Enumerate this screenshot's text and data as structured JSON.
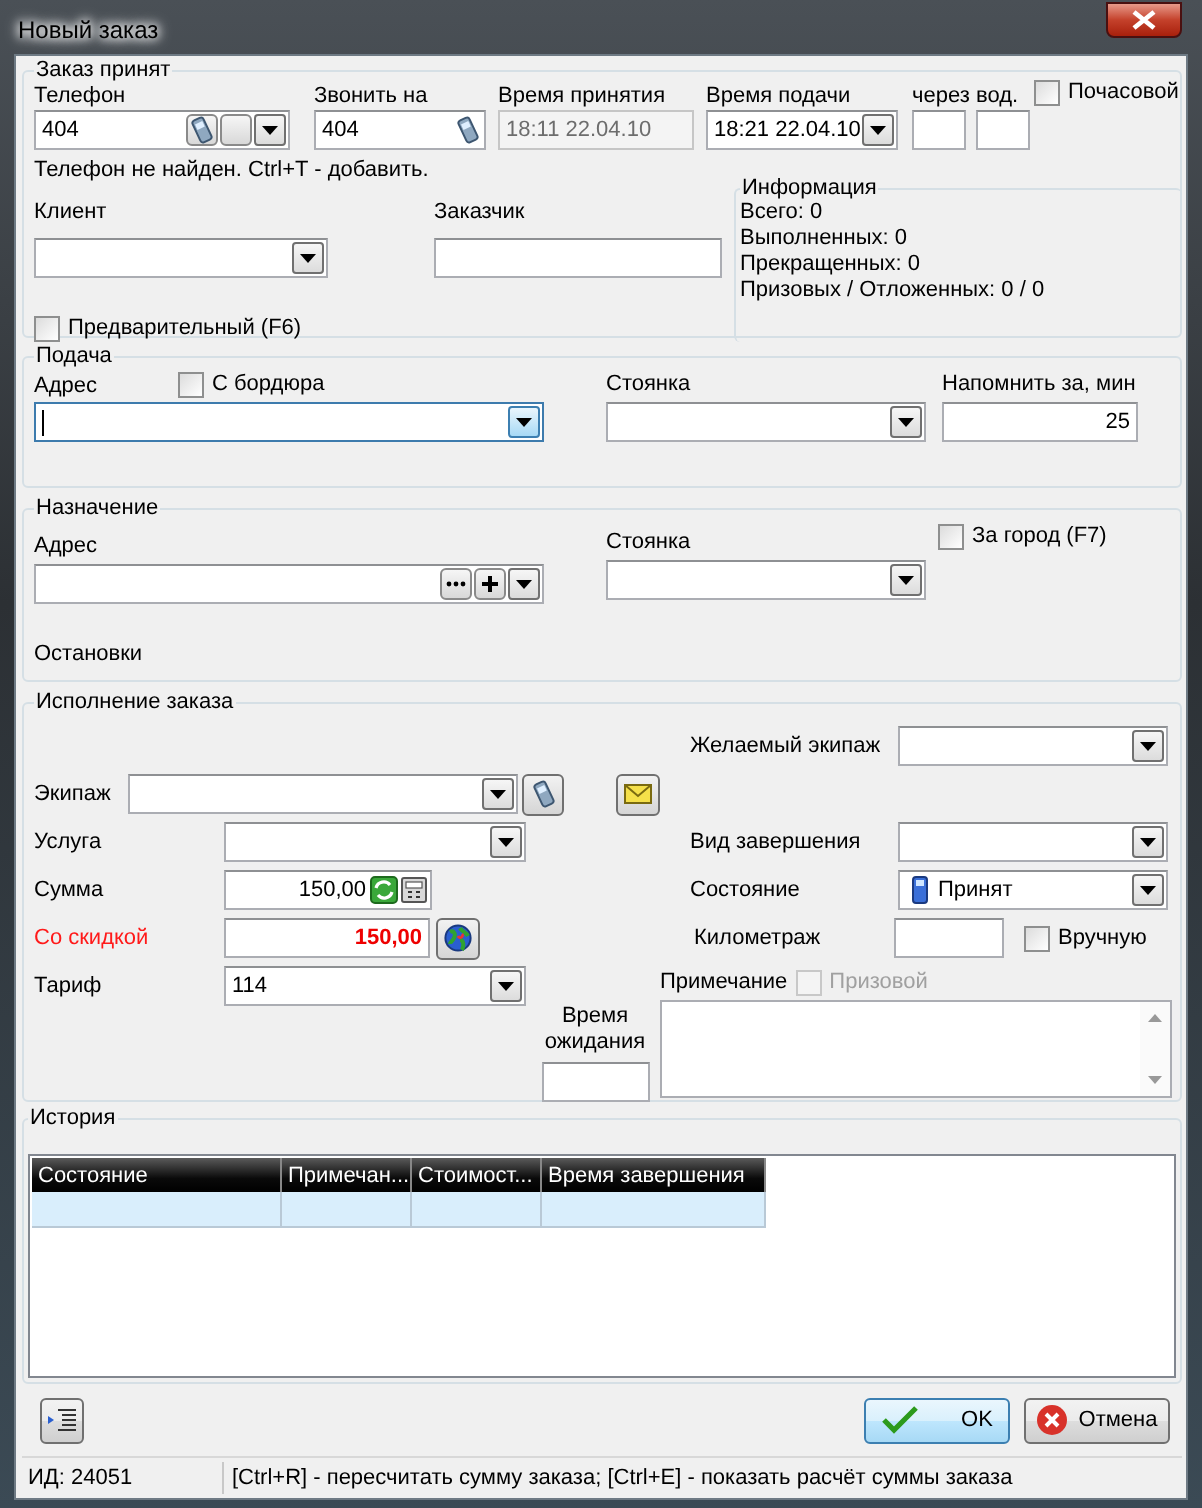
{
  "window": {
    "title": "Новый заказ"
  },
  "order_received": {
    "legend": "Заказ принят",
    "phone": {
      "label": "Телефон",
      "value": "404"
    },
    "call_to": {
      "label": "Звонить на",
      "value": "404"
    },
    "accept_time": {
      "label": "Время принятия",
      "value": "18:11 22.04.10",
      "disabled": true
    },
    "pickup_time": {
      "label": "Время подачи",
      "value": "18:21 22.04.10",
      "disabled": false
    },
    "after": {
      "label": "через"
    },
    "driver": {
      "label": "вод."
    },
    "hourly": {
      "label": "Почасовой",
      "checked": false,
      "disabled": false
    },
    "phone_hint": "Телефон не найден. Ctrl+T - добавить.",
    "client": {
      "label": "Клиент"
    },
    "customer": {
      "label": "Заказчик"
    },
    "preliminary": {
      "label": "Предварительный (F6)",
      "checked": false,
      "disabled": false
    },
    "info": {
      "legend": "Информация",
      "lines": [
        "Всего: 0",
        "Выполненных: 0",
        "Прекращенных: 0",
        "Призовых / Отложенных: 0 / 0"
      ]
    }
  },
  "pickup": {
    "legend": "Подача",
    "address": {
      "label": "Адрес",
      "focused": true
    },
    "curb": {
      "label": "С бордюра",
      "checked": false,
      "disabled": false
    },
    "parking": {
      "label": "Стоянка"
    },
    "remind": {
      "label": "Напомнить за, мин",
      "value": "25"
    }
  },
  "destination": {
    "legend": "Назначение",
    "address": {
      "label": "Адрес"
    },
    "parking": {
      "label": "Стоянка"
    },
    "out_of_town": {
      "label": "За город (F7)",
      "checked": false,
      "disabled": false
    },
    "stops_label": "Остановки"
  },
  "execution": {
    "legend": "Исполнение заказа",
    "desired_crew": {
      "label": "Желаемый экипаж"
    },
    "crew": {
      "label": "Экипаж"
    },
    "service": {
      "label": "Услуга"
    },
    "completion_type": {
      "label": "Вид завершения"
    },
    "sum": {
      "label": "Сумма",
      "value": "150,00"
    },
    "status": {
      "label": "Состояние",
      "value": "Принят"
    },
    "discounted": {
      "label": "Со скидкой",
      "value": "150,00"
    },
    "mileage": {
      "label": "Километраж"
    },
    "manual": {
      "label": "Вручную",
      "checked": false,
      "disabled": false
    },
    "tariff": {
      "label": "Тариф",
      "value": "114"
    },
    "note": {
      "label": "Примечание"
    },
    "prize": {
      "label": "Призовой",
      "checked": false,
      "disabled": true
    },
    "wait_time": {
      "label": "Время ожидания"
    }
  },
  "history": {
    "legend": "История",
    "columns": [
      "Состояние",
      "Примечан...",
      "Стоимост...",
      "Время завершения"
    ],
    "rows": [
      {
        "selected": true
      }
    ]
  },
  "buttons": [
    {
      "kind": "list"
    },
    {
      "kind": "ok",
      "label": "OK"
    },
    {
      "kind": "cancel",
      "label": "Отмена"
    }
  ],
  "status_bar": {
    "id": "ИД: 24051",
    "hint": "[Ctrl+R] - пересчитать сумму заказа; [Ctrl+E] - показать расчёт суммы заказа"
  }
}
